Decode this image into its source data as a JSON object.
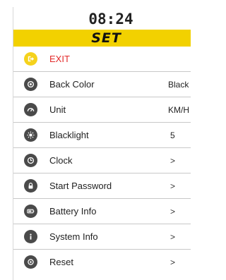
{
  "time": "08:24",
  "title": "SET",
  "menu": [
    {
      "label": "EXIT",
      "icon": "exit-icon",
      "value": ""
    },
    {
      "label": "Back Color",
      "icon": "palette-icon",
      "value": "Black"
    },
    {
      "label": "Unit",
      "icon": "speedometer-icon",
      "value": "KM/H"
    },
    {
      "label": "Blacklight",
      "icon": "sun-icon",
      "value": "5"
    },
    {
      "label": "Clock",
      "icon": "clock-icon",
      "value": ">"
    },
    {
      "label": "Start Password",
      "icon": "lock-icon",
      "value": ">"
    },
    {
      "label": "Battery Info",
      "icon": "battery-icon",
      "value": ">"
    },
    {
      "label": "System Info",
      "icon": "info-icon",
      "value": ">"
    },
    {
      "label": "Reset",
      "icon": "reset-icon",
      "value": ">"
    }
  ],
  "colors": {
    "accent": "#f2d100",
    "exit_text": "#e32b2b",
    "icon_bg": "#4a4a4a"
  }
}
